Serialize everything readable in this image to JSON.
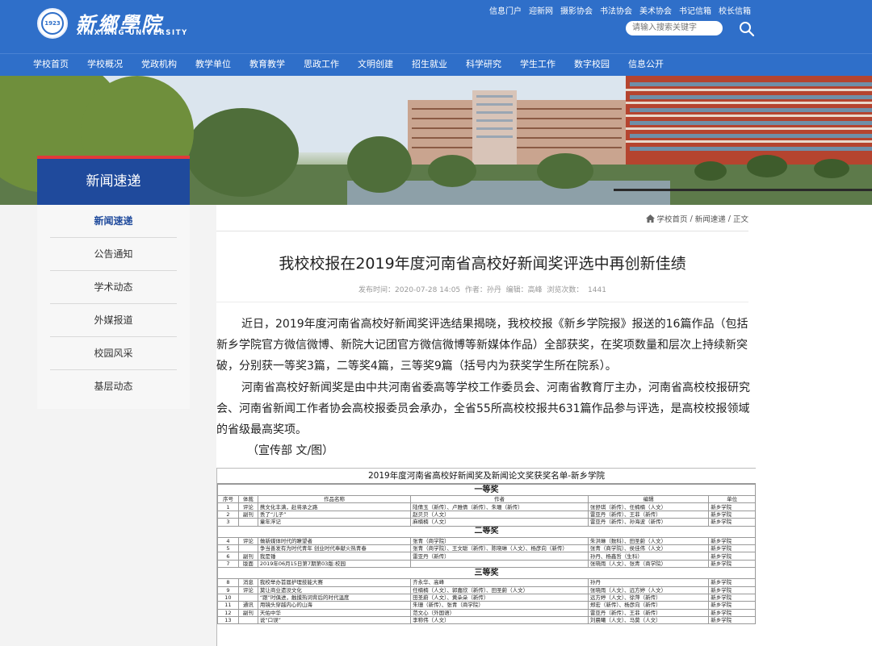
{
  "header": {
    "logo_seal_text": "1923",
    "logo_cn": "新鄉學院",
    "logo_en": "XINXIANG UNIVERSITY",
    "top_links": [
      "信息门户",
      "迎新网",
      "摄影协会",
      "书法协会",
      "美术协会",
      "书记信箱",
      "校长信箱"
    ],
    "search_placeholder": "请输入搜索关键字"
  },
  "nav": [
    "学校首页",
    "学校概况",
    "党政机构",
    "教学单位",
    "教育教学",
    "思政工作",
    "文明创建",
    "招生就业",
    "科学研究",
    "学生工作",
    "数字校园",
    "信息公开"
  ],
  "sidebar": {
    "title": "新闻速递",
    "items": [
      {
        "label": "新闻速递",
        "active": true
      },
      {
        "label": "公告通知",
        "active": false
      },
      {
        "label": "学术动态",
        "active": false
      },
      {
        "label": "外媒报道",
        "active": false
      },
      {
        "label": "校园风采",
        "active": false
      },
      {
        "label": "基层动态",
        "active": false
      }
    ]
  },
  "breadcrumb": [
    "学校首页",
    "新闻速递",
    "正文"
  ],
  "article": {
    "title": "我校校报在2019年度河南省高校好新闻奖评选中再创新佳绩",
    "meta": "发布时间：2020-07-28 14:05  作者：孙丹  编辑：高峰  浏览次数：  1441",
    "p1": "近日，2019年度河南省高校好新闻奖评选结果揭晓，我校校报《新乡学院报》报送的16篇作品（包括新乡学院官方微信微博、新院大记团官方微信微博等新媒体作品）全部获奖，在奖项数量和层次上持续新突破，分别获一等奖3篇，二等奖4篇，三等奖9篇（括号内为获奖学生所在院系）。",
    "p2": "河南省高校好新闻奖是由中共河南省委高等学校工作委员会、河南省教育厅主办，河南省高校校报研究会、河南省新闻工作者协会高校报委员会承办，全省55所高校校报共631篇作品参与评选，是高校校报领域的省级最高奖项。",
    "credit": "（宣传部 文/图）"
  },
  "award_table": {
    "title": "2019年度河南省高校好新闻奖及新闻论文奖获奖名单-新乡学院",
    "headers": [
      "序号",
      "体裁",
      "作品名称",
      "作者",
      "编辑",
      "单位"
    ],
    "sections": [
      {
        "name": "一等奖",
        "rows": [
          [
            "1",
            "评论",
            "携文化丰满，赴将承之路",
            "陆倩玉（新传）、卢雅倩（新传）、朱珊（新传）",
            "张舒琪（新传）、任楠楠（人文）",
            "新乡学院"
          ],
          [
            "2",
            "副刊",
            "丢了“儿子”",
            "赵贝贝（人文）",
            "雷亚丹（新传）、王菲（新传）",
            "新乡学院"
          ],
          [
            "3",
            "",
            "童年浮记",
            "麻楠楠（人文）",
            "雷亚丹（新传）、孙海波（新传）",
            "新乡学院"
          ]
        ]
      },
      {
        "name": "二等奖",
        "rows": [
          [
            "4",
            "评论",
            "做新媒体时代的瞭望者",
            "张青（商学院）",
            "朱洪琳（数科）、田圣蔚（人文）",
            "新乡学院"
          ],
          [
            "5",
            "",
            "争当善发有为时代青年 创业时代奉献火热青春",
            "张青（商学院）、王文聪（新传）、陈晓琳（人文）、杨彦向（新传）",
            "张青（商学院）、侯佳伟（人文）",
            "新乡学院"
          ],
          [
            "6",
            "副刊",
            "我是锤",
            "雷亚丹（新传）",
            "孙丹、杨鑫哲（生科）",
            "新乡学院"
          ],
          [
            "7",
            "版面",
            "2019年06月15日第7期第03版:校园",
            "",
            "张晓雨（人文）、张青（商学院）",
            "新乡学院"
          ]
        ]
      },
      {
        "name": "三等奖",
        "rows": [
          [
            "8",
            "消息",
            "我校举办首届护理技能大赛",
            "齐永华、高峰",
            "孙丹",
            "新乡学院"
          ],
          [
            "9",
            "评论",
            "莫让商业遗没文化",
            "任楠楠（人文）、郭嘉欣（新传）、田圣蔚（人文）",
            "张晓雨（人文）、远方婷（人文）",
            "新乡学院"
          ],
          [
            "10",
            "",
            "“跟”时俱进，触摸热词背后的时代温度",
            "田圣蔚（人文）、黄朵朵（新传）",
            "远方婷（人文）、徐萍（新传）",
            "新乡学院"
          ],
          [
            "11",
            "通讯",
            "用镜头穿越内心的山海",
            "朱珊（新传）、张青（商学院）",
            "郑宏（新传）、杨彦向（新传）",
            "新乡学院"
          ],
          [
            "12",
            "副刊",
            "天佑中华",
            "范文心（外国语）",
            "雷亚丹（新传）、王菲（新传）",
            "新乡学院"
          ],
          [
            "13",
            "",
            "说“口误”",
            "李称伟（人文）",
            "刘晨曦（人文）、马莫（人文）",
            "新乡学院"
          ]
        ]
      }
    ]
  },
  "colors": {
    "header_blue": "#2f6fc9",
    "sidebar_title": "#1f4a9c",
    "accent_red": "#e23a3a"
  }
}
